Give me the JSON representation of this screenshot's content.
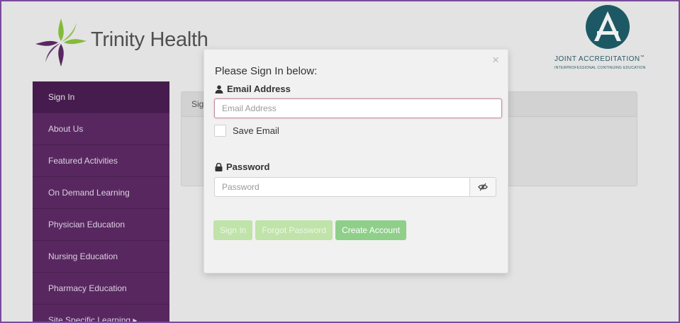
{
  "header": {
    "brand": "Trinity Health",
    "ja_title": "JOINT ACCREDITATION",
    "ja_tm": "™",
    "ja_subtitle": "INTERPROFESSIONAL CONTINUING EDUCATION"
  },
  "sidebar": {
    "items": [
      {
        "label": "Sign In",
        "active": true
      },
      {
        "label": "About Us"
      },
      {
        "label": "Featured Activities"
      },
      {
        "label": "On Demand Learning"
      },
      {
        "label": "Physician Education"
      },
      {
        "label": "Nursing Education"
      },
      {
        "label": "Pharmacy Education"
      },
      {
        "label": "Site Specific Learning ▸"
      }
    ]
  },
  "panel": {
    "header_label": "Sig"
  },
  "modal": {
    "close_label": "×",
    "title": "Please Sign In below:",
    "email_label": "Email Address",
    "email_placeholder": "Email Address",
    "email_value": "",
    "save_email_label": "Save Email",
    "password_label": "Password",
    "password_placeholder": "Password",
    "password_value": "",
    "sign_in_label": "Sign In",
    "forgot_label": "Forgot Password",
    "create_label": "Create Account"
  },
  "icons": {
    "user": "user-icon",
    "lock": "lock-icon",
    "eye": "eye-slash-icon",
    "close": "close-icon"
  },
  "colors": {
    "frame_border": "#7a4a9a",
    "sidebar_bg": "#5e2a66",
    "button_light": "#bfe3a8",
    "button_primary": "#8fcf8a",
    "brand_green": "#8dc63f",
    "brand_purple": "#5e2a66",
    "ja_teal": "#1f5f6b"
  }
}
